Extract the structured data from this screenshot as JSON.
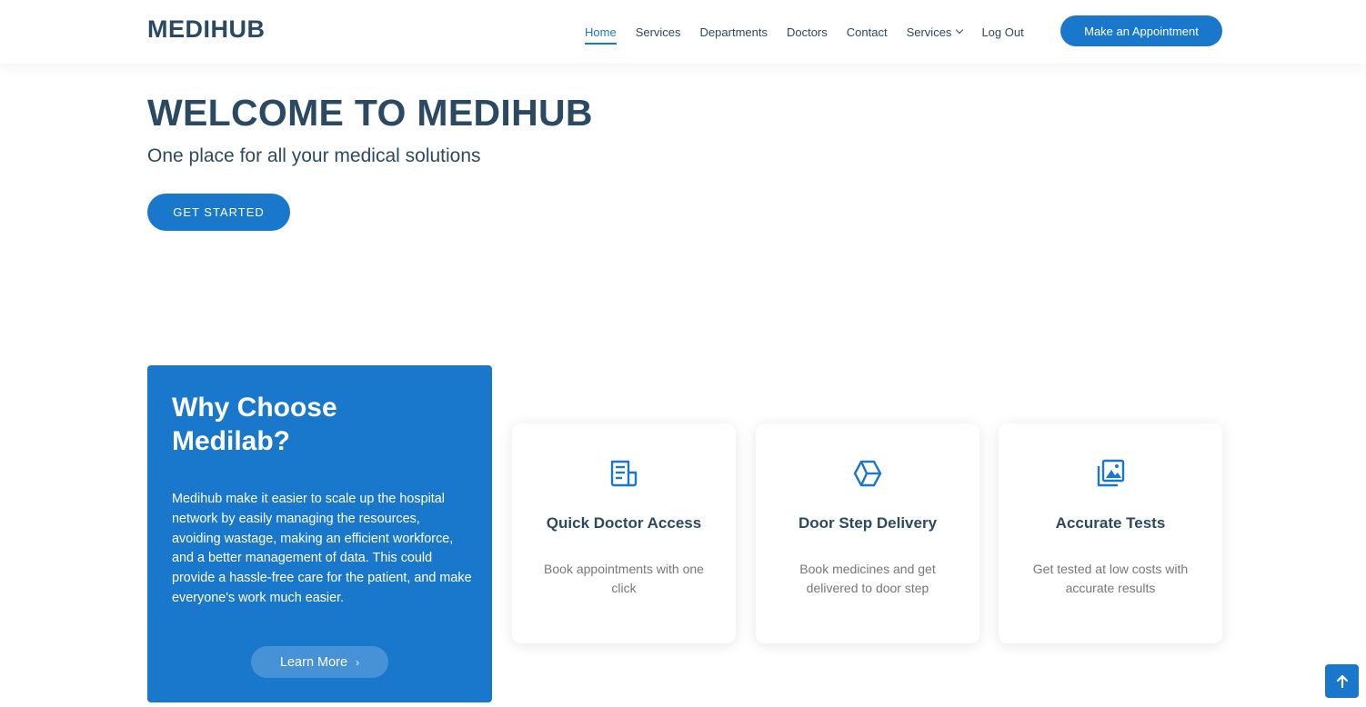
{
  "header": {
    "logo": "MEDIHUB",
    "nav": [
      {
        "label": "Home",
        "active": true
      },
      {
        "label": "Services"
      },
      {
        "label": "Departments"
      },
      {
        "label": "Doctors"
      },
      {
        "label": "Contact"
      },
      {
        "label": "Services",
        "dropdown": true
      },
      {
        "label": "Log Out"
      }
    ],
    "appointment_label": "Make an Appointment"
  },
  "hero": {
    "title": "WELCOME TO MEDIHUB",
    "subtitle": "One place for all your medical solutions",
    "cta_label": "GET STARTED"
  },
  "why": {
    "title": "Why Choose Medilab?",
    "text": "Medihub make it easier to scale up the hospital network by easily managing the resources, avoiding wastage, making an efficient workforce, and a better management of data. This could provide a hassle-free care for the patient, and make everyone's work much easier.",
    "learn_more_label": "Learn More",
    "learn_more_arrow": "›"
  },
  "features": [
    {
      "icon": "receipt-icon",
      "title": "Quick Doctor Access",
      "text": "Book appointments with one click"
    },
    {
      "icon": "cube-icon",
      "title": "Door Step Delivery",
      "text": "Book medicines and get delivered to door step"
    },
    {
      "icon": "images-icon",
      "title": "Accurate Tests",
      "text": "Get tested at low costs with accurate results"
    }
  ],
  "colors": {
    "accent": "#1977cc",
    "heading": "#2c4964",
    "muted": "#777777"
  },
  "back_to_top_icon": "arrow-up-icon"
}
